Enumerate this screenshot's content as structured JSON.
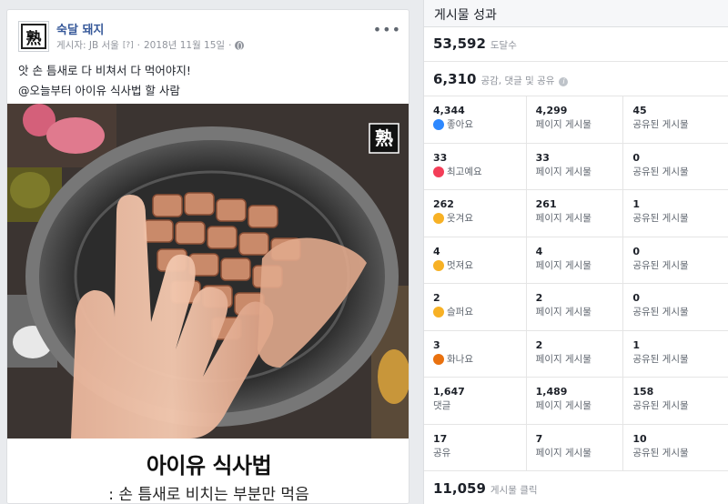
{
  "post": {
    "page_name": "숙달 돼지",
    "avatar_glyph": "熟",
    "meta_prefix": "게시자: JB 서울",
    "meta_help": "[?]",
    "meta_date": "2018년 11월 15일",
    "text_line1": "앗 손 틈새로 다 비쳐서 다 먹어야지!",
    "text_line2": "@오늘부터 아이유 식사법 할 사람",
    "photo_logo": "熟",
    "caption_title": "아이유 식사법",
    "caption_sub": ": 손 틈새로 비치는 부분만 먹음"
  },
  "panel": {
    "title": "게시물 성과",
    "reach_value": "53,592",
    "reach_label": "도달수",
    "engagement_value": "6,310",
    "engagement_label": "공감, 댓글 및 공유",
    "rows": [
      {
        "total": "4,344",
        "label": "좋아요",
        "icon": "like-icon",
        "icon_color": "#2d88ff",
        "page": "4,299",
        "page_label": "페이지 게시물",
        "shared": "45",
        "shared_label": "공유된 게시물"
      },
      {
        "total": "33",
        "label": "최고예요",
        "icon": "love-icon",
        "icon_color": "#f33e58",
        "page": "33",
        "page_label": "페이지 게시물",
        "shared": "0",
        "shared_label": "공유된 게시물"
      },
      {
        "total": "262",
        "label": "웃겨요",
        "icon": "haha-icon",
        "icon_color": "#f7b125",
        "page": "261",
        "page_label": "페이지 게시물",
        "shared": "1",
        "shared_label": "공유된 게시물"
      },
      {
        "total": "4",
        "label": "멋져요",
        "icon": "wow-icon",
        "icon_color": "#f7b125",
        "page": "4",
        "page_label": "페이지 게시물",
        "shared": "0",
        "shared_label": "공유된 게시물"
      },
      {
        "total": "2",
        "label": "슬퍼요",
        "icon": "sad-icon",
        "icon_color": "#f7b125",
        "page": "2",
        "page_label": "페이지 게시물",
        "shared": "0",
        "shared_label": "공유된 게시물"
      },
      {
        "total": "3",
        "label": "화나요",
        "icon": "angry-icon",
        "icon_color": "#e9710f",
        "page": "2",
        "page_label": "페이지 게시물",
        "shared": "1",
        "shared_label": "공유된 게시물"
      },
      {
        "total": "1,647",
        "label": "댓글",
        "icon": "",
        "icon_color": "",
        "page": "1,489",
        "page_label": "페이지 게시물",
        "shared": "158",
        "shared_label": "공유된 게시물"
      },
      {
        "total": "17",
        "label": "공유",
        "icon": "",
        "icon_color": "",
        "page": "7",
        "page_label": "페이지 게시물",
        "shared": "10",
        "shared_label": "공유된 게시물"
      }
    ],
    "clicks_value": "11,059",
    "clicks_label": "게시물 클릭"
  }
}
